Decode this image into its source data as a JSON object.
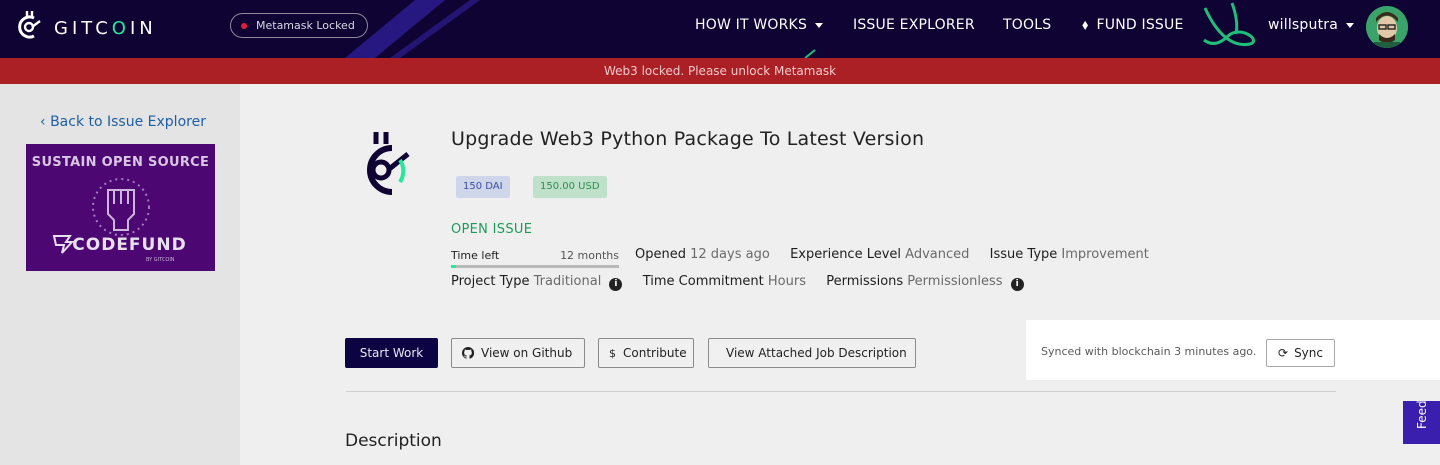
{
  "navbar": {
    "logo_text_pre": "GITC",
    "logo_text_o": "O",
    "logo_text_post": "IN",
    "metamask_status": "Metamask Locked",
    "links": {
      "how_it_works": "HOW IT WORKS",
      "issue_explorer": "ISSUE EXPLORER",
      "tools": "TOOLS",
      "fund_issue": "FUND ISSUE"
    },
    "username": "willsputra"
  },
  "alert": {
    "text": "Web3 locked. Please unlock Metamask"
  },
  "sidebar": {
    "back_link": "Back to Issue Explorer",
    "ad": {
      "title": "SUSTAIN OPEN SOURCE",
      "brand": "CODEFUND",
      "sub": "BY GITCOIN"
    }
  },
  "issue": {
    "title": "Upgrade Web3 Python Package To Latest Version",
    "badge_token": "150 DAI",
    "badge_usd": "150.00 USD",
    "status": "OPEN ISSUE",
    "time_left_label": "Time left",
    "time_left_value": "12 months",
    "time_left_progress": 0.03,
    "opened_label": "Opened",
    "opened_value": "12 days ago",
    "experience_label": "Experience Level",
    "experience_value": "Advanced",
    "issue_type_label": "Issue Type",
    "issue_type_value": "Improvement",
    "project_type_label": "Project Type",
    "project_type_value": "Traditional",
    "time_commitment_label": "Time Commitment",
    "time_commitment_value": "Hours",
    "permissions_label": "Permissions",
    "permissions_value": "Permissionless"
  },
  "actions": {
    "start_work": "Start Work",
    "view_github": "View on Github",
    "contribute": "Contribute",
    "view_job": "View Attached Job Description"
  },
  "sync": {
    "text": "Synced with blockchain 3 minutes ago.",
    "button": "Sync"
  },
  "description_heading": "Description",
  "feedback_label": "Feedback",
  "colors": {
    "nav_bg": "#0e0333",
    "alert_bg": "#aa2024",
    "accent_green": "#25e899",
    "primary_button": "#0c0442",
    "ad_bg": "#4c0772"
  }
}
